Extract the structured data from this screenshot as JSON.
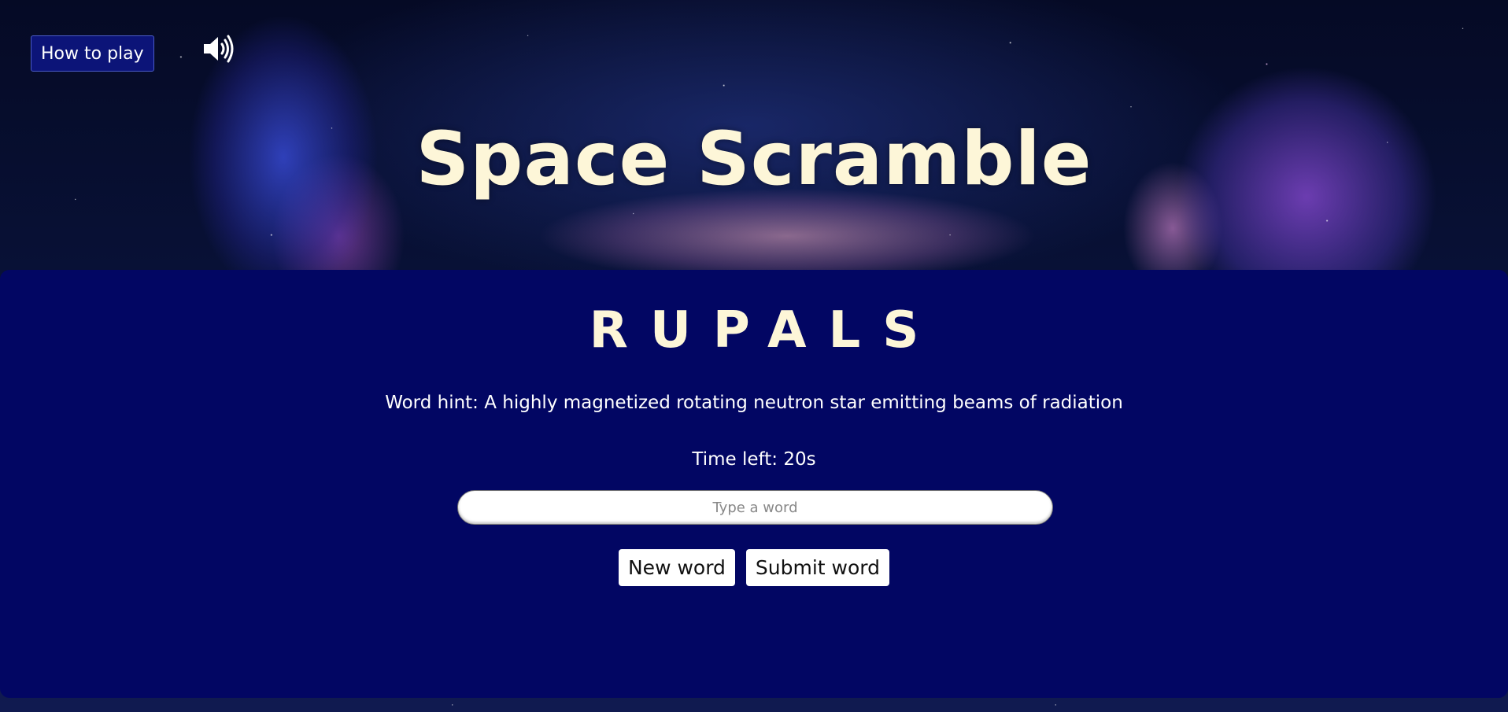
{
  "header": {
    "how_to_play_label": "How to play",
    "sound_icon": "speaker-volume-icon",
    "title": "Space Scramble"
  },
  "game": {
    "scrambled_word": "RUPALS",
    "hint": "Word hint: A highly magnetized rotating neutron star emitting beams of radiation",
    "timer": "Time left: 20s",
    "input_value": "",
    "input_placeholder": "Type a word",
    "new_word_label": "New word",
    "submit_word_label": "Submit word"
  },
  "colors": {
    "panel": "#020663",
    "title": "#fdf6d8",
    "how_to_play_bg": "#0c1478"
  }
}
